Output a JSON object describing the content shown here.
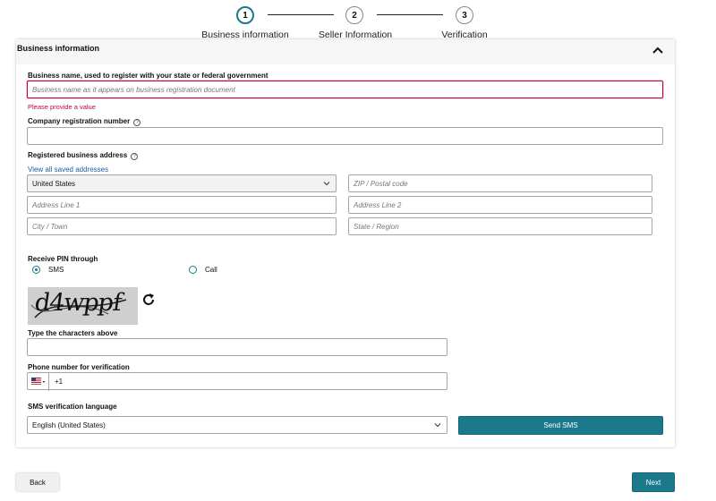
{
  "stepper": {
    "steps": [
      {
        "number": "1",
        "label": "Business information"
      },
      {
        "number": "2",
        "label": "Seller Information"
      },
      {
        "number": "3",
        "label": "Verification"
      }
    ]
  },
  "section": {
    "title": "Business information"
  },
  "business_name": {
    "label": "Business name, used to register with your state or federal government",
    "placeholder": "Business name as it appears on business registration document",
    "error": "Please provide a value"
  },
  "company_registration": {
    "label": "Company registration number",
    "value": ""
  },
  "address": {
    "label": "Registered business address",
    "view_saved_link": "View all saved addresses",
    "country": "United States",
    "zip_placeholder": "ZIP / Postal code",
    "line1_placeholder": "Address Line 1",
    "line2_placeholder": "Address Line 2",
    "city_placeholder": "City / Town",
    "state_placeholder": "State / Region"
  },
  "pin": {
    "label": "Receive PIN through",
    "options": [
      "SMS",
      "Call"
    ],
    "selected": "SMS"
  },
  "captcha": {
    "text": "d4wppf",
    "input_label": "Type the characters above",
    "value": ""
  },
  "phone": {
    "label": "Phone number for verification",
    "country_code": "+1"
  },
  "sms_language": {
    "label": "SMS verification language",
    "selected": "English (United States)",
    "send_button": "Send SMS"
  },
  "footer": {
    "back_label": "Back",
    "next_label": "Next"
  },
  "colors": {
    "accent": "#1a7a8c",
    "error": "#c40048",
    "link": "#1a5fa3"
  },
  "icons": {
    "help": "question-circle-icon",
    "collapse": "chevron-up-icon",
    "refresh": "refresh-icon",
    "flag": "us-flag-icon"
  }
}
